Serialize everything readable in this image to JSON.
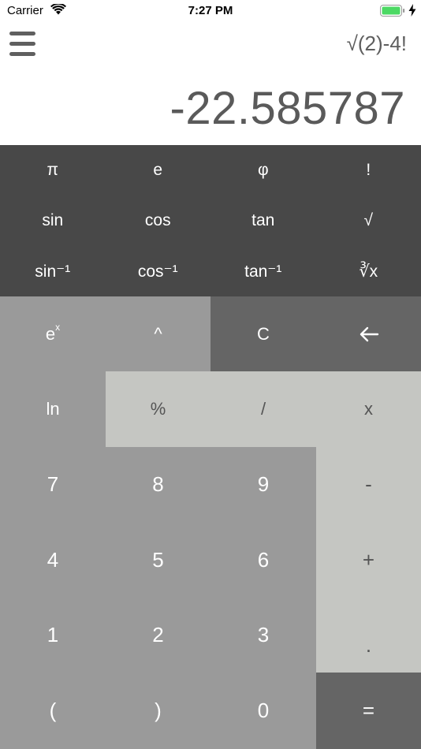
{
  "status_bar": {
    "carrier": "Carrier",
    "time": "7:27 PM"
  },
  "header": {
    "menu_icon": "hamburger-menu-icon",
    "expression": "√(2)-4!",
    "result": "-22.585787"
  },
  "colors": {
    "scientific_panel": "#484848",
    "light_gray_key": "#9a9a9a",
    "mid_gray_key": "#656565",
    "pale_key": "#c5c6c2",
    "display_text": "#5a5a5a",
    "battery_green": "#4cd964"
  },
  "scientific_keys": [
    {
      "label": "π"
    },
    {
      "label": "e"
    },
    {
      "label": "φ"
    },
    {
      "label": "!"
    },
    {
      "label": "sin"
    },
    {
      "label": "cos"
    },
    {
      "label": "tan"
    },
    {
      "label": "√"
    },
    {
      "label": "sin⁻¹"
    },
    {
      "label": "cos⁻¹"
    },
    {
      "label": "tan⁻¹"
    },
    {
      "label": "∛x"
    }
  ],
  "keys": {
    "exp_base": "e",
    "exp_sup": "x",
    "power": "^",
    "clear": "C",
    "backspace": "←",
    "ln": "ln",
    "percent": "%",
    "divide": "/",
    "multiply": "x",
    "seven": "7",
    "eight": "8",
    "nine": "9",
    "minus": "-",
    "four": "4",
    "five": "5",
    "six": "6",
    "plus": "+",
    "one": "1",
    "two": "2",
    "three": "3",
    "decimal": ".",
    "open_paren": "(",
    "close_paren": ")",
    "zero": "0",
    "equals": "="
  }
}
